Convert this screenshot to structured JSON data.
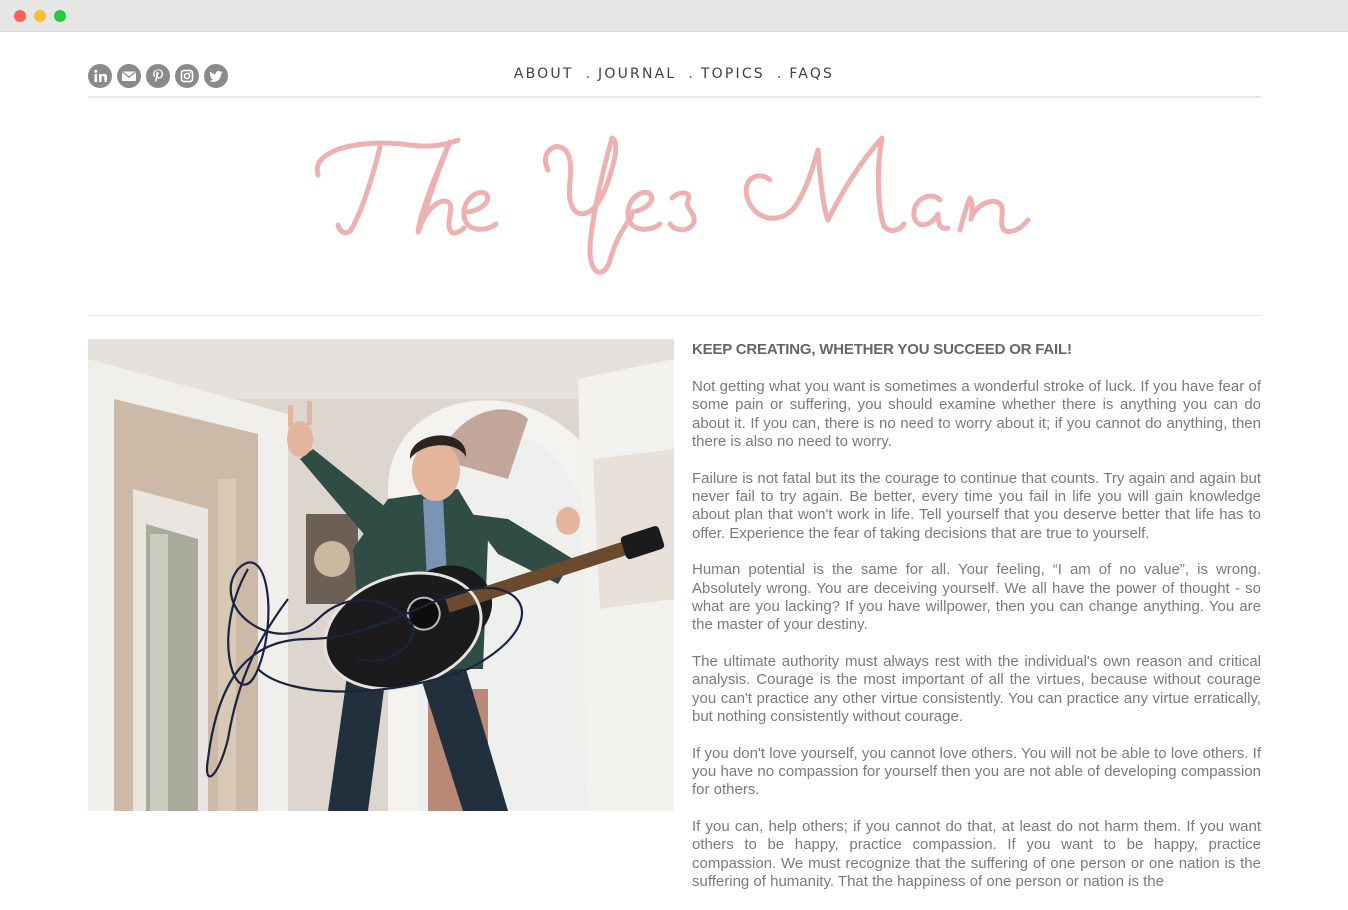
{
  "window": {
    "controls": [
      "close",
      "minimize",
      "zoom"
    ]
  },
  "social": [
    {
      "name": "linkedin-icon",
      "glyph": "in"
    },
    {
      "name": "email-icon"
    },
    {
      "name": "pinterest-icon",
      "glyph": "P"
    },
    {
      "name": "instagram-icon"
    },
    {
      "name": "twitter-icon"
    }
  ],
  "nav": {
    "items": [
      "ABOUT",
      "JOURNAL",
      "TOPICS",
      "FAQS"
    ],
    "separator": "."
  },
  "site": {
    "logo_text": "The Yes Man",
    "logo_color": "#eeb1b1"
  },
  "article": {
    "title": "KEEP CREATING, WHETHER YOU SUCCEED OR FAIL!",
    "paragraphs": [
      "Not getting what you want is sometimes a wonderful stroke of luck. If you have fear of some pain or suffering, you should examine whether there is anything you can do about it. If you can, there is no need to worry about it; if you cannot do anything, then there is also no need to worry.",
      "Failure is not fatal but its the courage to continue that counts. Try again and again but never fail to try again. Be better, every time you fail in life you will gain knowledge about plan that won't work in life. Tell yourself that you deserve better that life has to offer. Experience the fear of taking decisions that are true to yourself.",
      "Human potential is the same for all. Your feeling, “I am of no value”, is wrong. Absolutely wrong. You are deceiving yourself. We all have the power of thought - so what are you lacking? If you have willpower, then you can change anything. You are the master of your destiny.",
      "The ultimate authority must always rest with the individual's own reason and critical analysis. Courage is the most important of all the virtues, because without courage you can't practice any other virtue consistently. You can practice any virtue erratically, but nothing consistently without courage.",
      "If you don't love yourself, you cannot love others. You will not be able to love others. If you have no compassion for yourself then you are not able of developing compassion for others.",
      "If you can, help others; if you cannot do that, at least do not harm them. If you want others to be happy, practice compassion. If you want to be happy, practice compassion. We must recognize that the suffering of one person or one nation is the suffering of humanity. That the happiness of one person or nation is the"
    ]
  },
  "colors": {
    "icon_gray": "#8a8a8a",
    "text_gray": "#7a7a7a",
    "nav_text": "#3f3f3f",
    "accent_pink": "#eeb1b1"
  }
}
